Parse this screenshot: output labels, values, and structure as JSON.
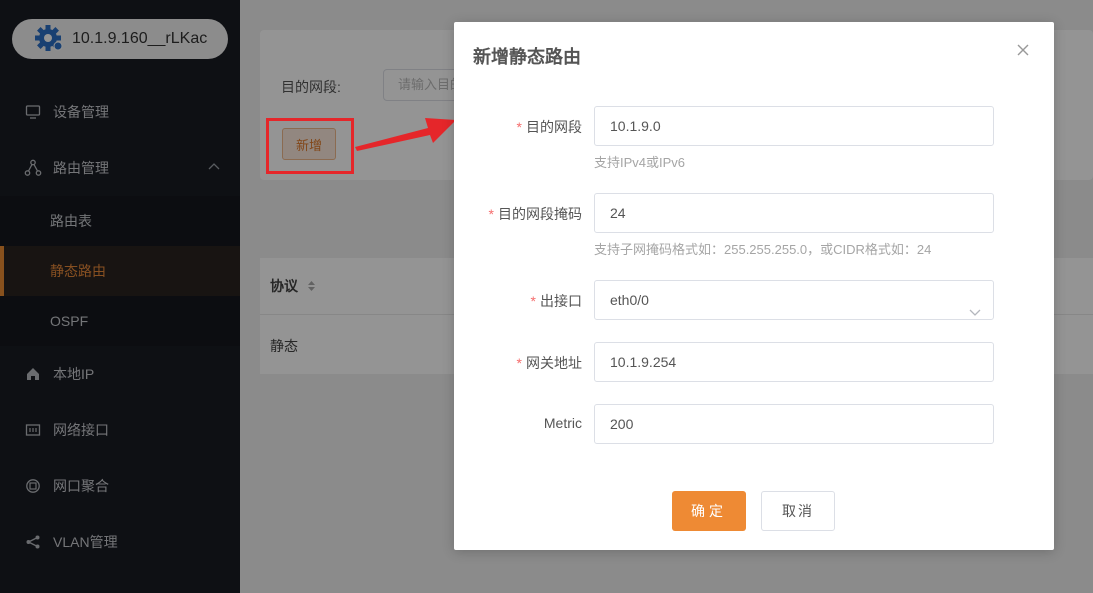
{
  "device": {
    "name": "10.1.9.160__rLKac"
  },
  "sidebar": {
    "items": [
      {
        "label": "设备管理",
        "icon": "monitor-icon"
      },
      {
        "label": "路由管理",
        "icon": "route-icon"
      },
      {
        "label": "本地IP",
        "icon": "home-icon"
      },
      {
        "label": "网络接口",
        "icon": "interface-icon"
      },
      {
        "label": "网口聚合",
        "icon": "aggregate-icon"
      },
      {
        "label": "VLAN管理",
        "icon": "share-icon"
      }
    ],
    "route_sub": [
      {
        "label": "路由表"
      },
      {
        "label": "静态路由"
      },
      {
        "label": "OSPF"
      }
    ]
  },
  "main": {
    "filter_label": "目的网段:",
    "filter_placeholder": "请输入目的网",
    "add_button": "新增",
    "table": {
      "header_protocol": "协议",
      "row_protocol": "静态"
    }
  },
  "modal": {
    "title": "新增静态路由",
    "fields": {
      "dest": {
        "label": "目的网段",
        "value": "10.1.9.0",
        "hint": "支持IPv4或IPv6"
      },
      "mask": {
        "label": "目的网段掩码",
        "value": "24",
        "hint": "支持子网掩码格式如：255.255.255.0，或CIDR格式如：24"
      },
      "iface": {
        "label": "出接口",
        "value": "eth0/0"
      },
      "gateway": {
        "label": "网关地址",
        "value": "10.1.9.254"
      },
      "metric": {
        "label": "Metric",
        "value": "200"
      }
    },
    "ok": "确定",
    "cancel": "取消"
  },
  "colors": {
    "accent": "#ee8a34",
    "required": "#f56c6c",
    "highlight": "#e5262a"
  }
}
